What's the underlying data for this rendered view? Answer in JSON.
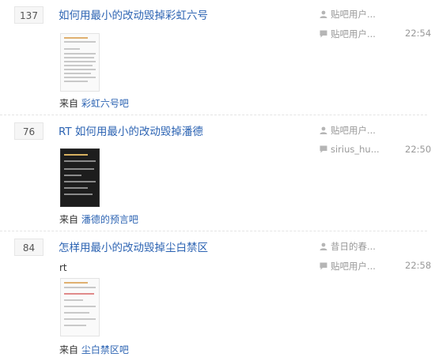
{
  "threads": [
    {
      "reply_count": "137",
      "title": "如何用最小的改动毁掉彩虹六号",
      "body": "",
      "from_label": "来自",
      "forum": "彩虹六号吧",
      "author": "贴吧用户...",
      "last_replier": "贴吧用户...",
      "last_time": "22:54"
    },
    {
      "reply_count": "76",
      "title": "RT 如何用最小的改动毁掉潘德",
      "body": "",
      "from_label": "来自",
      "forum": "潘德的预言吧",
      "author": "贴吧用户...",
      "last_replier": "sirius_hu...",
      "last_time": "22:50"
    },
    {
      "reply_count": "84",
      "title": "怎样用最小的改动毁掉尘白禁区",
      "body": "rt",
      "from_label": "来自",
      "forum": "尘白禁区吧",
      "author": "昔日的春...",
      "last_replier": "贴吧用户...",
      "last_time": "22:58"
    }
  ],
  "icons": {
    "author": "user-icon",
    "reply": "comment-icon"
  },
  "colors": {
    "link": "#2d64b3",
    "meta": "#999999",
    "icon": "#b5b5b5"
  }
}
